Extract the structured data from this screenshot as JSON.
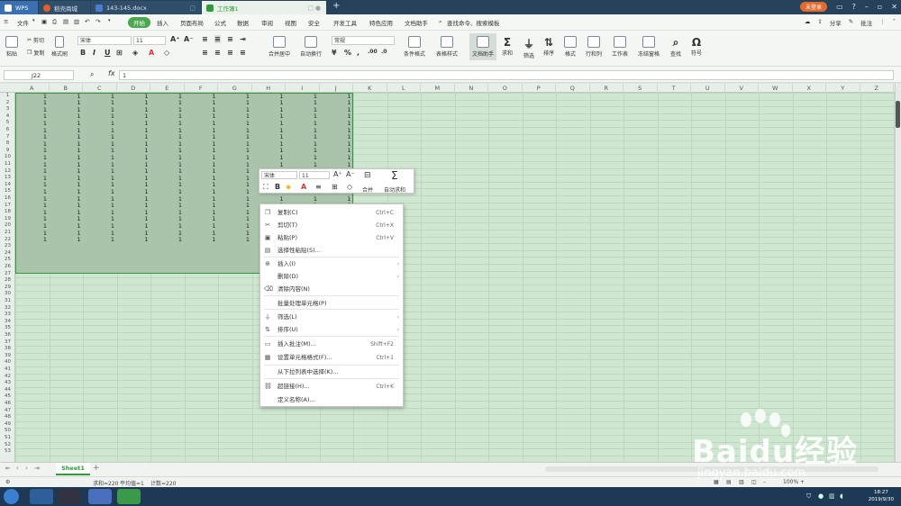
{
  "tabs": {
    "wps": "WPS",
    "store": "稻壳商城",
    "doc": "143-145.docx",
    "sheet": "工作簿1",
    "new_tab": "+"
  },
  "window": {
    "login": "未登录"
  },
  "menu": {
    "items": [
      "文件",
      "开始",
      "插入",
      "页面布局",
      "公式",
      "数据",
      "审阅",
      "视图",
      "安全",
      "开发工具",
      "特色应用",
      "文档助手"
    ],
    "search": "查找命令、搜索模板",
    "share": "分享",
    "comment": "批注"
  },
  "ribbon": {
    "paste": "粘贴",
    "cut": "剪切",
    "copy": "复制",
    "format_painter": "格式刷",
    "font_name": "宋体",
    "font_size": "11",
    "merge": "合并居中",
    "wrap": "自动换行",
    "number_format": "常规",
    "cond_format": "条件格式",
    "table_style": "表格样式",
    "doc_helper": "文档助手",
    "sum": "求和",
    "filter": "筛选",
    "sort": "排序",
    "format": "格式",
    "row_col": "行和列",
    "worksheet": "工作表",
    "freeze": "冻结窗格",
    "find": "查找",
    "symbol": "符号",
    "bold": "B",
    "italic": "I",
    "underline": "U"
  },
  "formula_bar": {
    "cell_ref": "J22",
    "fx": "fx",
    "value": "1"
  },
  "grid": {
    "columns": [
      "A",
      "B",
      "C",
      "D",
      "E",
      "F",
      "G",
      "H",
      "I",
      "J",
      "K",
      "L",
      "M",
      "N",
      "O",
      "P",
      "Q",
      "R",
      "S",
      "T",
      "U",
      "V",
      "W",
      "X",
      "Y",
      "Z"
    ],
    "rows": [
      "1",
      "2",
      "3",
      "4",
      "5",
      "6",
      "7",
      "8",
      "9",
      "10",
      "11",
      "12",
      "13",
      "14",
      "15",
      "16",
      "17",
      "18",
      "19",
      "20",
      "21",
      "22",
      "23",
      "24",
      "25",
      "26",
      "27",
      "28",
      "29",
      "30",
      "31",
      "32",
      "33",
      "34",
      "35",
      "36",
      "37",
      "38",
      "39",
      "40",
      "41",
      "42",
      "43",
      "44",
      "45",
      "46",
      "47",
      "48",
      "49",
      "50",
      "51",
      "52",
      "53"
    ],
    "cell_value": "1"
  },
  "mini_toolbar": {
    "font_name": "宋体",
    "font_size": "11",
    "merge": "合并",
    "autosum": "自动求和",
    "bold": "B"
  },
  "context_menu": [
    {
      "icon": "copy",
      "label": "复制(C)",
      "shortcut": "Ctrl+C"
    },
    {
      "icon": "cut",
      "label": "剪切(T)",
      "shortcut": "Ctrl+X"
    },
    {
      "icon": "paste",
      "label": "粘贴(P)",
      "shortcut": "Ctrl+V"
    },
    {
      "icon": "paste-special",
      "label": "选择性粘贴(S)...",
      "shortcut": ""
    },
    {
      "icon": "insert",
      "label": "插入(I)",
      "shortcut": ""
    },
    {
      "icon": "",
      "label": "删除(D)",
      "shortcut": ""
    },
    {
      "icon": "clear",
      "label": "清除内容(N)",
      "shortcut": ""
    },
    {
      "icon": "",
      "label": "批量处理单元格(P)",
      "shortcut": ""
    },
    {
      "icon": "filter",
      "label": "筛选(L)",
      "shortcut": ""
    },
    {
      "icon": "sort",
      "label": "排序(U)",
      "shortcut": ""
    },
    {
      "icon": "comment",
      "label": "插入批注(M)...",
      "shortcut": "Shift+F2"
    },
    {
      "icon": "format-cells",
      "label": "设置单元格格式(F)...",
      "shortcut": "Ctrl+1"
    },
    {
      "icon": "",
      "label": "从下拉列表中选择(K)...",
      "shortcut": ""
    },
    {
      "icon": "link",
      "label": "超链接(H)...",
      "shortcut": "Ctrl+K"
    },
    {
      "icon": "",
      "label": "定义名称(A)...",
      "shortcut": ""
    }
  ],
  "sheets": {
    "active": "Sheet1",
    "add": "+"
  },
  "status": {
    "sum": "求和=220",
    "average": "平均值=1",
    "count": "计数=220",
    "zoom": "100%"
  },
  "taskbar": {
    "time": "18:27",
    "date": "2019/9/30"
  },
  "watermark": {
    "text": "Baidu经验",
    "url": "jingyan.baidu.com"
  }
}
